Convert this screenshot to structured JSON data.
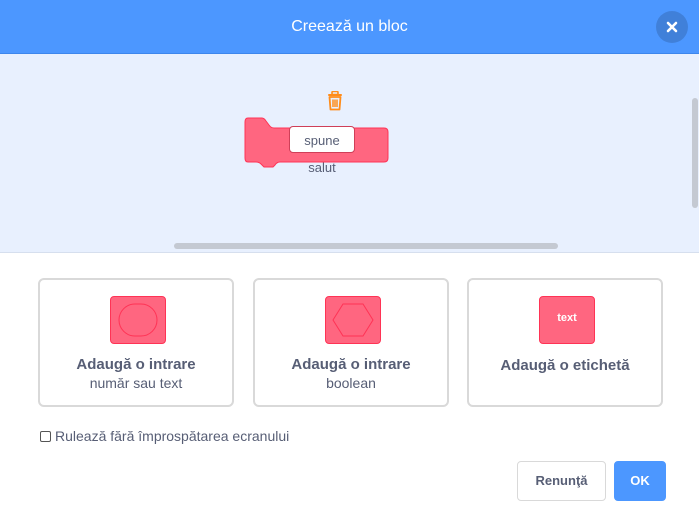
{
  "dialog": {
    "title": "Creează un bloc"
  },
  "block": {
    "input_text": "spune salut",
    "color": "#ff6680"
  },
  "options": [
    {
      "title": "Adaugă o intrare",
      "subtitle": "număr sau text",
      "shape": "round"
    },
    {
      "title": "Adaugă o intrare",
      "subtitle": "boolean",
      "shape": "diamond"
    },
    {
      "title": "Adaugă o etichetă",
      "subtitle": "",
      "shape": "label",
      "swatch_text": "text"
    }
  ],
  "checkbox": {
    "label": "Rulează fără împrospătarea ecranului",
    "checked": false
  },
  "buttons": {
    "cancel": "Renunţă",
    "ok": "OK"
  },
  "colors": {
    "header": "#4c97ff",
    "workspace": "#e8f0fe",
    "block": "#ff6680",
    "trash": "#ff8c1a"
  }
}
